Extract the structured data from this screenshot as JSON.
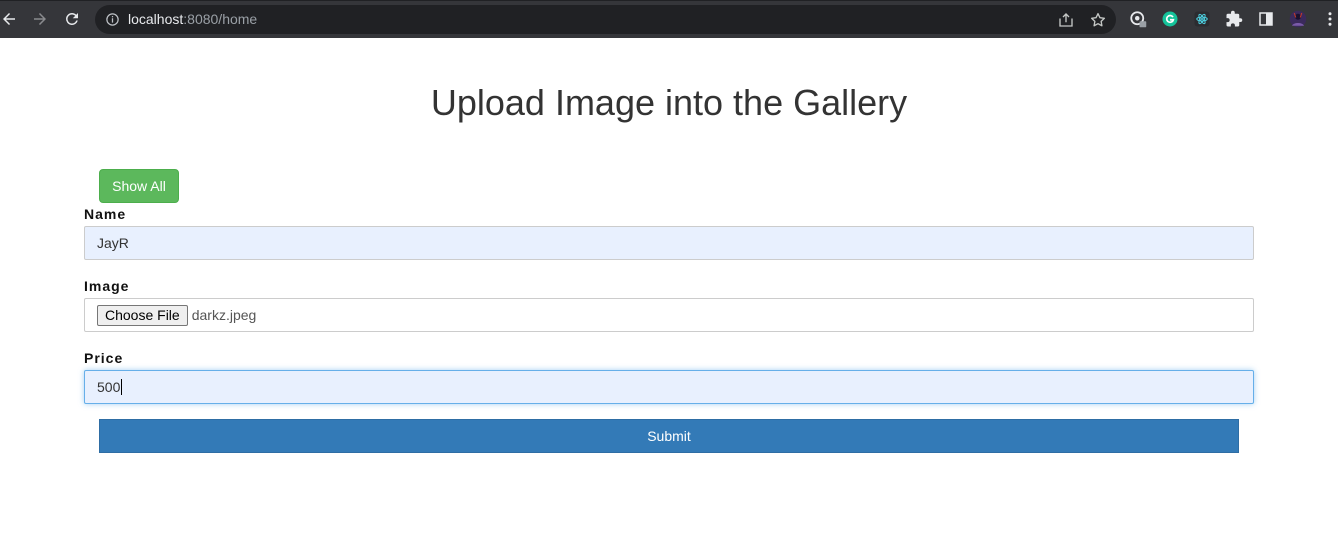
{
  "browser": {
    "url_host": "localhost",
    "url_path": ":8080/home",
    "icons": {
      "back": "arrow-left-icon",
      "forward": "arrow-right-icon",
      "reload": "reload-icon",
      "info": "info-icon",
      "share": "share-icon",
      "bookmark": "star-icon",
      "extensions": "puzzle-icon",
      "side_panel": "side-panel-icon",
      "menu": "kebab-menu-icon"
    }
  },
  "page": {
    "title": "Upload Image into the Gallery",
    "show_all_label": "Show All",
    "form": {
      "name_label": "Name",
      "name_value": "JayR",
      "image_label": "Image",
      "choose_file_label": "Choose File",
      "file_name": "darkz.jpeg",
      "price_label": "Price",
      "price_value": "500",
      "submit_label": "Submit"
    }
  },
  "colors": {
    "chrome_bg": "#35363a",
    "omnibox_bg": "#202124",
    "show_all_bg": "#5cb85c",
    "submit_bg": "#337ab7",
    "autofill_bg": "#e8f0fe",
    "focus_border": "#66afe9"
  }
}
